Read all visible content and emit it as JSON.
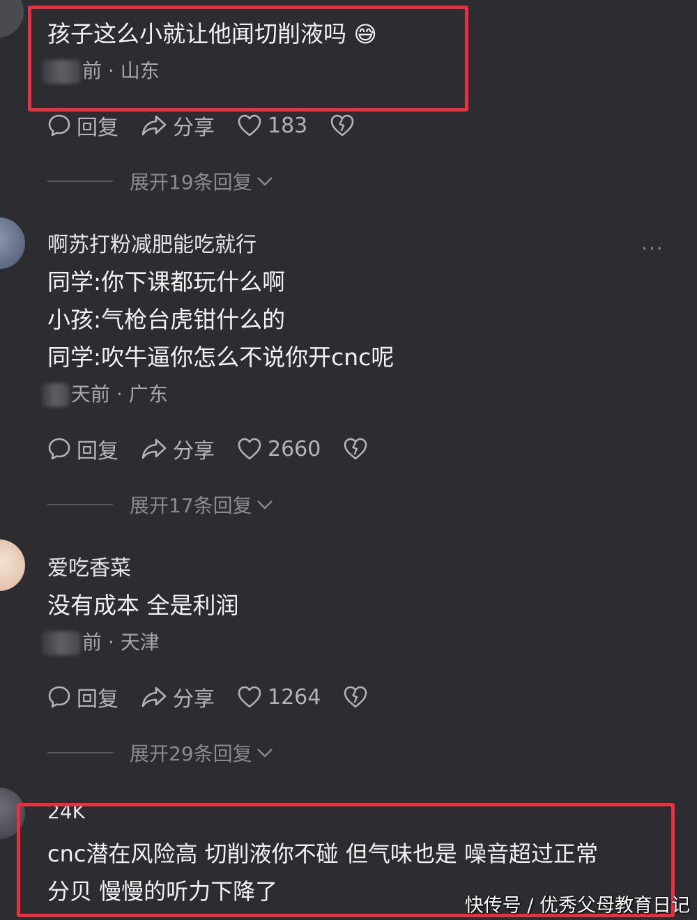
{
  "comments": [
    {
      "username": "",
      "text_lines": [
        "孩子这么小就让他闻切削液吗"
      ],
      "emoji": "😅",
      "time_suffix": "前",
      "location": "山东",
      "reply_label": "回复",
      "share_label": "分享",
      "like_count": "183",
      "expand_label": "展开19条回复"
    },
    {
      "username": "啊苏打粉减肥能吃就行",
      "text_lines": [
        "同学:你下课都玩什么啊",
        "小孩:气枪台虎钳什么的",
        "同学:吹牛逼你怎么不说你开cnc呢"
      ],
      "time_suffix": "天前",
      "location": "广东",
      "reply_label": "回复",
      "share_label": "分享",
      "like_count": "2660",
      "expand_label": "展开17条回复"
    },
    {
      "username": "爱吃香菜",
      "text_lines": [
        "没有成本 全是利润"
      ],
      "time_suffix": "前",
      "location": "天津",
      "reply_label": "回复",
      "share_label": "分享",
      "like_count": "1264",
      "expand_label": "展开29条回复"
    },
    {
      "username": "24K",
      "text_lines": [
        "cnc潜在风险高 切削液你不碰 但气味也是 噪音超过正常",
        "分贝 慢慢的听力下降了"
      ]
    }
  ],
  "more_label": "···",
  "location_separator": "·",
  "watermark": "快传号 / 优秀父母教育日记",
  "highlight_color": "#e8313f",
  "background_color": "#2d2c31"
}
